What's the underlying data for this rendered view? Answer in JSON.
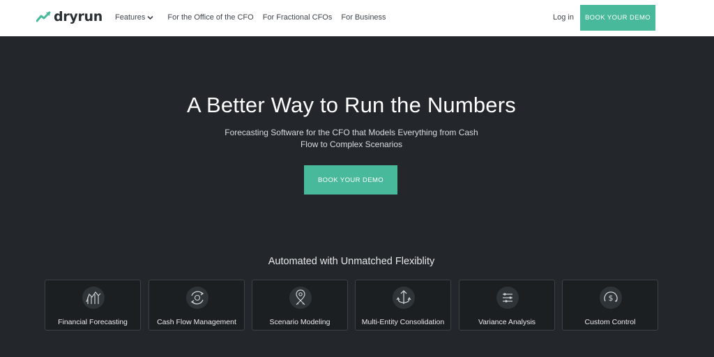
{
  "header": {
    "brand": "dryrun",
    "nav": [
      "Features",
      "For the Office of the CFO",
      "For Fractional CFOs",
      "For Business"
    ],
    "login": "Log in",
    "cta": "BOOK YOUR DEMO"
  },
  "hero": {
    "title": "A Better Way to Run the Numbers",
    "subtitle": "Forecasting Software for the CFO that Models Everything from Cash Flow to Complex Scenarios",
    "cta": "BOOK YOUR DEMO"
  },
  "features": {
    "title": "Automated with Unmatched Flexiblity",
    "cards": [
      {
        "label": "Financial Forecasting",
        "icon": "forecast-chart-icon"
      },
      {
        "label": "Cash Flow Management",
        "icon": "cash-cycle-icon"
      },
      {
        "label": "Scenario Modeling",
        "icon": "scenario-pin-icon"
      },
      {
        "label": "Multi-Entity Consolidation",
        "icon": "consolidation-arrow-icon"
      },
      {
        "label": "Variance Analysis",
        "icon": "variance-lines-icon"
      },
      {
        "label": "Custom Control",
        "icon": "dollar-gauge-icon"
      }
    ]
  },
  "colors": {
    "accent": "#48b99a",
    "background": "#23272b",
    "card": "#1c1f22",
    "header": "#ffffff"
  }
}
